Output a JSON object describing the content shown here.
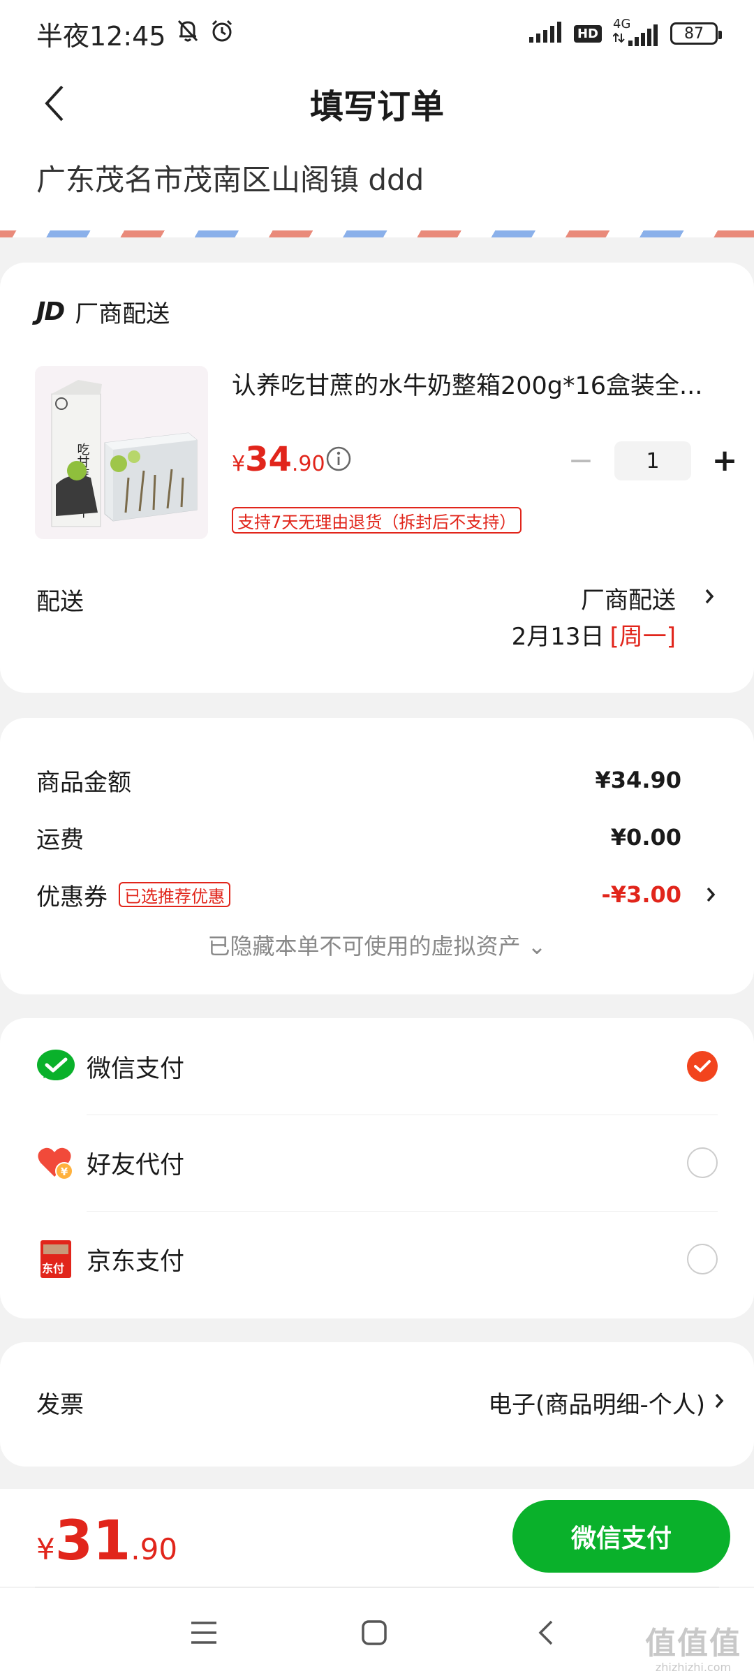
{
  "status_bar": {
    "time": "半夜12:45",
    "network": "4G",
    "hd": "HD",
    "battery": "87"
  },
  "header": {
    "title": "填写订单"
  },
  "address": {
    "text": "广东茂名市茂南区山阁镇 ddd"
  },
  "shop": {
    "logo": "JD",
    "name": "厂商配送"
  },
  "product": {
    "title": "认养吃甘蔗的水牛奶整箱200g*16盒装全...",
    "price_symbol": "¥",
    "price_int": "34",
    "price_dec": ".90",
    "quantity": "1",
    "return_policy": "支持7天无理由退货（拆封后不支持）",
    "image_text": "吃甘蔗的水牛"
  },
  "delivery": {
    "label": "配送",
    "method": "厂商配送",
    "date": "2月13日",
    "weekday": "[周一]"
  },
  "price_summary": {
    "goods_label": "商品金额",
    "goods_value": "¥34.90",
    "shipping_label": "运费",
    "shipping_value": "¥0.00",
    "coupon_label": "优惠券",
    "coupon_tag": "已选推荐优惠",
    "coupon_value": "-¥3.00",
    "hidden_assets": "已隐藏本单不可使用的虚拟资产 ⌄"
  },
  "payment": {
    "options": [
      {
        "label": "微信支付",
        "icon": "wechat-pay-icon",
        "selected": true
      },
      {
        "label": "好友代付",
        "icon": "friend-pay-icon",
        "selected": false
      },
      {
        "label": "京东支付",
        "icon": "jd-pay-icon",
        "selected": false
      }
    ],
    "jd_pay_icon_text": "东付"
  },
  "invoice": {
    "label": "发票",
    "value": "电子(商品明细-个人)"
  },
  "bottom_bar": {
    "total_symbol": "¥",
    "total_int": "31",
    "total_dec": ".90",
    "pay_button": "微信支付"
  },
  "watermark": {
    "main": "值值值",
    "sub": "zhizhizhi.com"
  },
  "colors": {
    "accent_red": "#e1251b",
    "wechat_green": "#0ab12b",
    "radio_selected": "#f2441d"
  }
}
